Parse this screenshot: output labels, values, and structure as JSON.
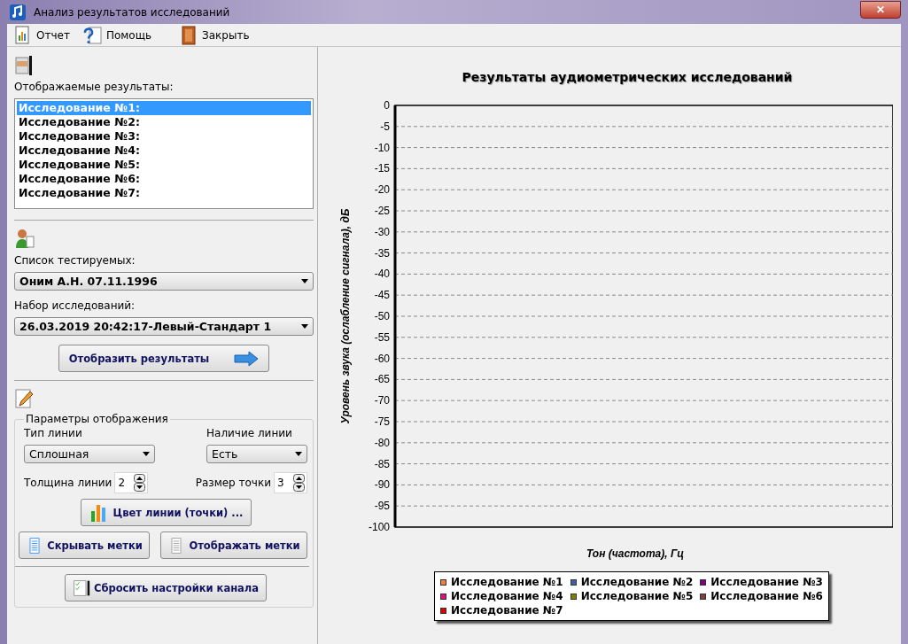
{
  "window": {
    "title": "Анализ результатов исследований",
    "close": "✕"
  },
  "menu": [
    "Отчет",
    "Помощь",
    "Закрыть"
  ],
  "results": {
    "label": "Отображаемые результаты:",
    "items": [
      {
        "label": "Исследование №1:",
        "selected": true
      },
      {
        "label": "Исследование №2:",
        "selected": false
      },
      {
        "label": "Исследование №3:",
        "selected": false
      },
      {
        "label": "Исследование №4:",
        "selected": false
      },
      {
        "label": "Исследование №5:",
        "selected": false
      },
      {
        "label": "Исследование №6:",
        "selected": false
      },
      {
        "label": "Исследование №7:",
        "selected": false
      }
    ]
  },
  "subjects": {
    "label": "Список тестируемых:",
    "value": "Оним А.Н. 07.11.1996"
  },
  "sets": {
    "label": "Набор исследований:",
    "value": "26.03.2019 20:42:17-Левый-Стандарт 1"
  },
  "show_button": "Отобразить результаты",
  "params": {
    "title": "Параметры отображения",
    "line_type_label": "Тип линии",
    "line_type": "Сплошная",
    "line_presence_label": "Наличие линии",
    "line_presence": "Есть",
    "thickness_label": "Толщина линии",
    "thickness": "2",
    "point_size_label": "Размер точки",
    "point_size": "3",
    "color_button": "Цвет линии (точки) ...",
    "hide_button": "Скрывать метки",
    "show_marks_button": "Отображать метки"
  },
  "reset_button": "Сбросить настройки канала",
  "chart": {
    "title": "Результаты аудиометрических исследований",
    "xlabel": "Тон (частота), Гц",
    "ylabel": "Уровень звука (ослабление сигнала), дБ",
    "y_tick_labels": [
      "0",
      "-5",
      "-10",
      "-15",
      "-20",
      "-25",
      "-30",
      "-35",
      "-40",
      "-45",
      "-50",
      "-55",
      "-60",
      "-65",
      "-70",
      "-75",
      "-80",
      "-85",
      "-90",
      "-95",
      "-100"
    ],
    "legend": [
      {
        "label": "Исследование №1",
        "color": "#f08040"
      },
      {
        "label": "Исследование №2",
        "color": "#4060a0"
      },
      {
        "label": "Исследование №3",
        "color": "#800080"
      },
      {
        "label": "Исследование №4",
        "color": "#e0107a"
      },
      {
        "label": "Исследование №5",
        "color": "#808000"
      },
      {
        "label": "Исследование №6",
        "color": "#804040"
      },
      {
        "label": "Исследование №7",
        "color": "#e00000"
      }
    ]
  }
}
